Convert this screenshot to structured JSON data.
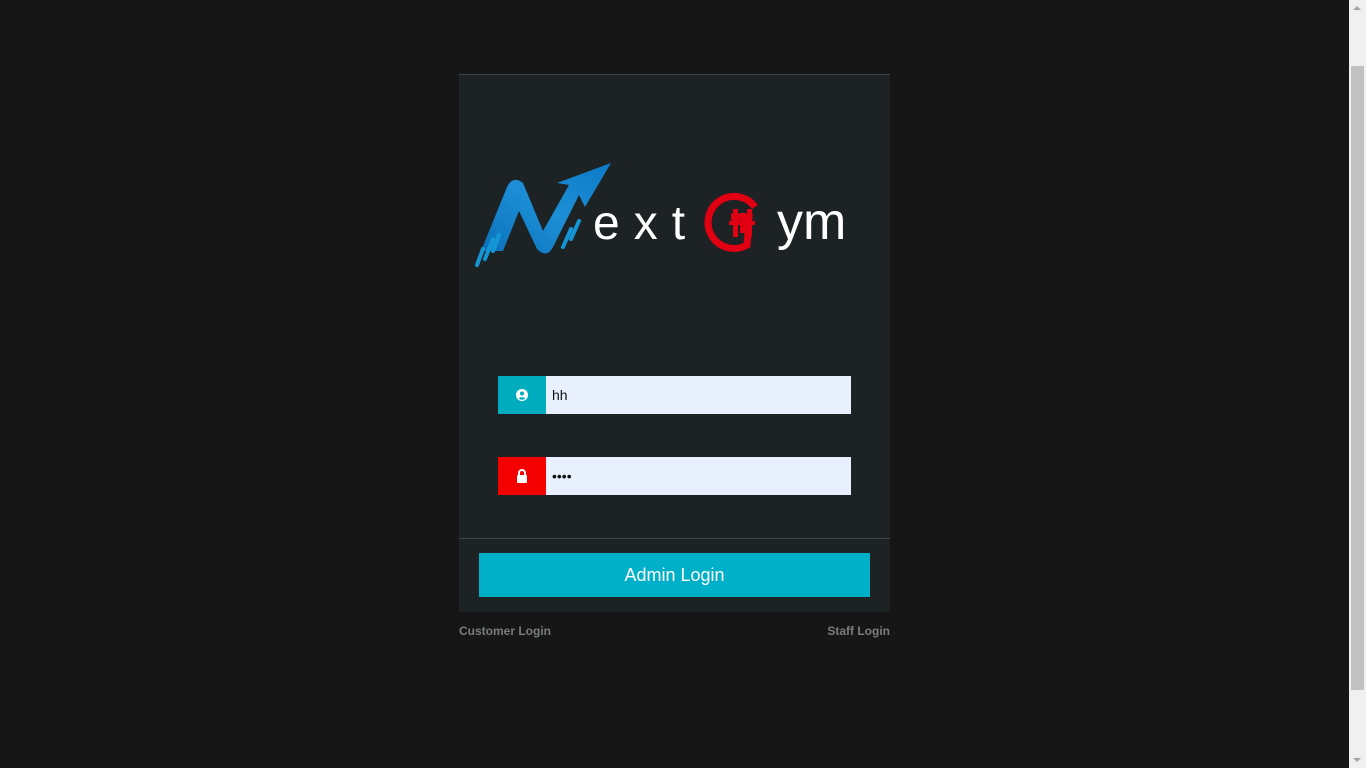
{
  "brand": {
    "logo_text": "NextGym",
    "colors": {
      "accent_blue": "#00adbf",
      "accent_red": "#f40000",
      "button": "#00b0c8",
      "card_bg": "#1d2224",
      "page_bg": "#161616"
    }
  },
  "form": {
    "username": {
      "icon": "user-circle-icon",
      "value": "hh",
      "placeholder": ""
    },
    "password": {
      "icon": "lock-icon",
      "value": "hhhh",
      "placeholder": ""
    },
    "submit_label": "Admin Login"
  },
  "links": {
    "customer_login": "Customer Login",
    "staff_login": "Staff Login"
  }
}
